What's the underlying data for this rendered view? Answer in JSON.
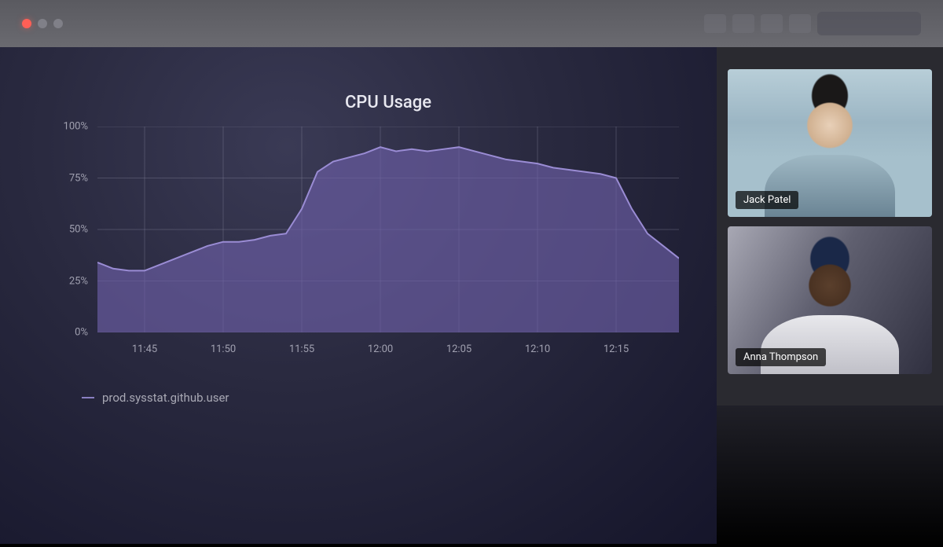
{
  "topbar": {
    "title": ""
  },
  "chart": {
    "title": "CPU Usage",
    "legend": {
      "series_label": "prod.sysstat.github.user",
      "series_color": "#8a7fc2"
    },
    "y_ticks": [
      "0%",
      "25%",
      "50%",
      "75%",
      "100%"
    ],
    "x_ticks": [
      "11:45",
      "11:50",
      "11:55",
      "12:00",
      "12:05",
      "12:10",
      "12:15"
    ]
  },
  "participants": [
    {
      "name": "Jack Patel"
    },
    {
      "name": "Anna Thompson"
    }
  ],
  "chart_data": {
    "type": "area",
    "title": "CPU Usage",
    "xlabel": "",
    "ylabel": "",
    "ylim": [
      0,
      100
    ],
    "x": [
      "11:42",
      "11:43",
      "11:44",
      "11:45",
      "11:46",
      "11:47",
      "11:48",
      "11:49",
      "11:50",
      "11:51",
      "11:52",
      "11:53",
      "11:54",
      "11:55",
      "11:56",
      "11:57",
      "11:58",
      "11:59",
      "12:00",
      "12:01",
      "12:02",
      "12:03",
      "12:04",
      "12:05",
      "12:06",
      "12:07",
      "12:08",
      "12:09",
      "12:10",
      "12:11",
      "12:12",
      "12:13",
      "12:14",
      "12:15",
      "12:16",
      "12:17",
      "12:18",
      "12:19"
    ],
    "series": [
      {
        "name": "prod.sysstat.github.user",
        "color": "#8a7fc2",
        "values": [
          34,
          31,
          30,
          30,
          33,
          36,
          39,
          42,
          44,
          44,
          45,
          47,
          48,
          60,
          78,
          83,
          85,
          87,
          90,
          88,
          89,
          88,
          89,
          90,
          88,
          86,
          84,
          83,
          82,
          80,
          79,
          78,
          77,
          75,
          60,
          48,
          42,
          36
        ]
      }
    ],
    "x_ticks": [
      "11:45",
      "11:50",
      "11:55",
      "12:00",
      "12:05",
      "12:10",
      "12:15"
    ],
    "y_ticks": [
      0,
      25,
      50,
      75,
      100
    ]
  }
}
